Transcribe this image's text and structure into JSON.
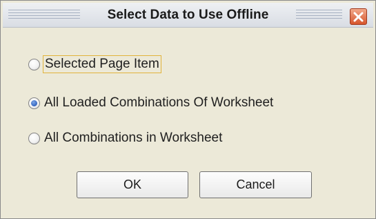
{
  "dialog": {
    "title": "Select Data to Use Offline",
    "options": [
      {
        "label": "Selected Page Item",
        "checked": false,
        "focused": true
      },
      {
        "label": "All Loaded Combinations Of Worksheet",
        "checked": true,
        "focused": false
      },
      {
        "label": "All Combinations in Worksheet",
        "checked": false,
        "focused": false
      }
    ],
    "ok_label": "OK",
    "cancel_label": "Cancel",
    "close_icon": "close-icon"
  }
}
